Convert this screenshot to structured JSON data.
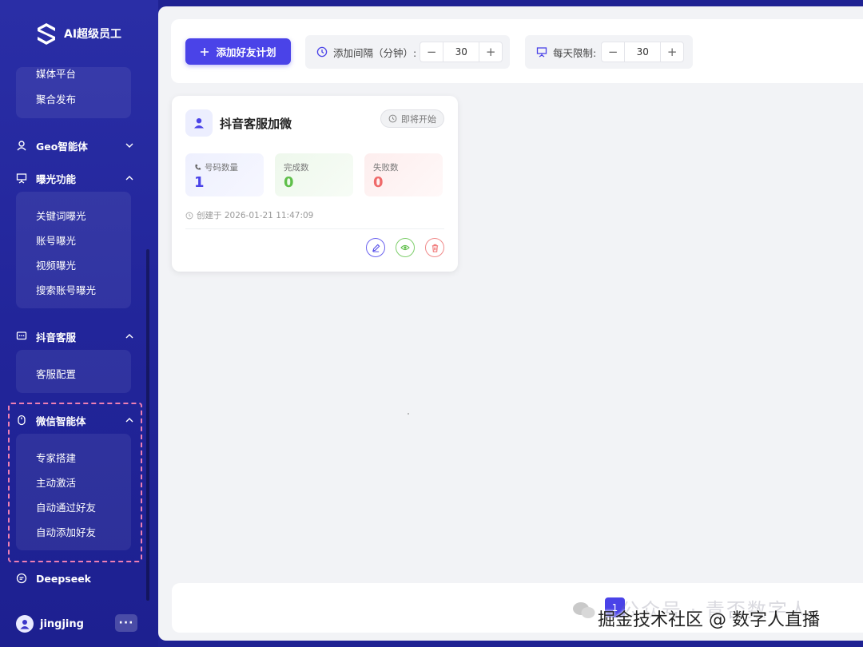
{
  "brand": {
    "name": "AI超级员工"
  },
  "sidebar": {
    "media_group": {
      "items": [
        {
          "label": "媒体平台"
        },
        {
          "label": "聚合发布"
        }
      ]
    },
    "geo": {
      "label": "Geo智能体"
    },
    "exposure": {
      "label": "曝光功能",
      "items": [
        {
          "label": "关键词曝光"
        },
        {
          "label": "账号曝光"
        },
        {
          "label": "视频曝光"
        },
        {
          "label": "搜索账号曝光"
        }
      ]
    },
    "douyin_cs": {
      "label": "抖音客服",
      "items": [
        {
          "label": "客服配置"
        }
      ]
    },
    "wechat": {
      "label": "微信智能体",
      "items": [
        {
          "label": "专家搭建"
        },
        {
          "label": "主动激活"
        },
        {
          "label": "自动通过好友"
        },
        {
          "label": "自动添加好友"
        }
      ]
    },
    "deepseek": {
      "label": "Deepseek"
    },
    "user": {
      "name": "jingjing",
      "more": "···"
    }
  },
  "toolbar": {
    "add_plan_label": "添加好友计划",
    "interval": {
      "label": "添加间隔（分钟）:",
      "value": "30",
      "minus": "−",
      "plus": "+"
    },
    "daily_limit": {
      "label": "每天限制:",
      "value": "30",
      "minus": "−",
      "plus": "+"
    }
  },
  "plan_card": {
    "title": "抖音客服加微",
    "status": "即将开始",
    "stats": [
      {
        "label": "号码数量",
        "value": "1",
        "color": "#4a43e8"
      },
      {
        "label": "完成数",
        "value": "0",
        "color": "#5fbf4a"
      },
      {
        "label": "失败数",
        "value": "0",
        "color": "#ef6a6a"
      }
    ],
    "created": "创建于 2026-01-21 11:47:09"
  },
  "pagination": {
    "current": "1"
  },
  "watermark": {
    "faint": "公众号 · 青否数字人",
    "main": "掘金技术社区 @ 数字人直播"
  }
}
